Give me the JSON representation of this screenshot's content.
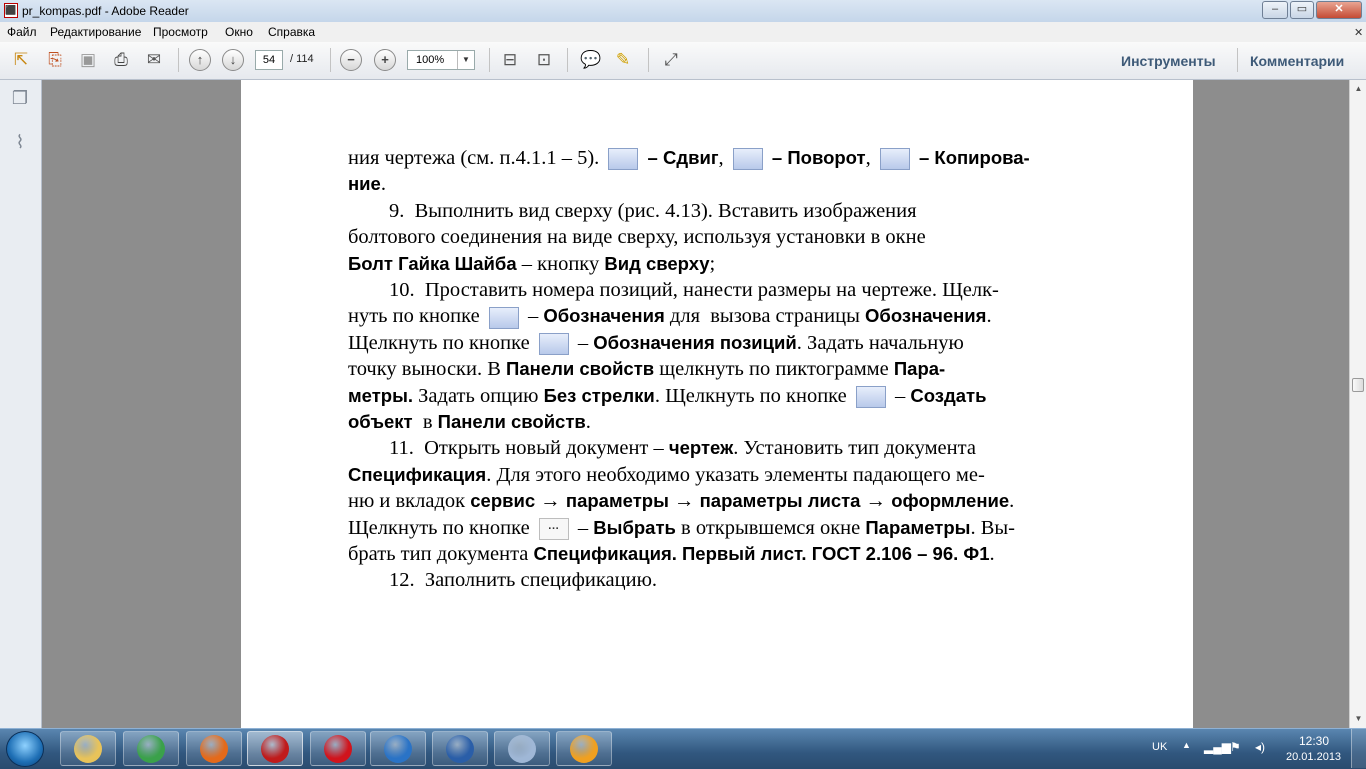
{
  "window": {
    "title": "pr_kompas.pdf - Adobe Reader",
    "app_icon": "pdf-icon",
    "controls": [
      "minimize-icon",
      "maximize-icon",
      "close-icon"
    ]
  },
  "menu": [
    "Файл",
    "Редактирование",
    "Просмотр",
    "Окно",
    "Справка"
  ],
  "toolbar": {
    "current_page": "54",
    "total_pages": "/ 114",
    "zoom": "100%",
    "tools_label": "Инструменты",
    "comments_label": "Комментарии",
    "buttons": [
      "open-icon",
      "create-pdf-icon",
      "save-icon",
      "print-icon",
      "email-icon",
      "page-up-icon",
      "page-down-icon",
      "zoom-out-icon",
      "zoom-in-icon",
      "fit-page-icon",
      "fit-width-icon",
      "comment-icon",
      "highlight-icon",
      "expand-icon"
    ]
  },
  "nav_panel": [
    "pages-icon",
    "attachments-icon"
  ],
  "document": {
    "lines": [
      {
        "parts": [
          {
            "t": "ния чертежа (см. п.4.1.1 – 5). "
          },
          {
            "icon": "shift-tool-icon"
          },
          {
            "b": " – Сдвиг"
          },
          {
            "t": ", "
          },
          {
            "icon": "rotate-tool-icon"
          },
          {
            "b": " – Поворот"
          },
          {
            "t": ", "
          },
          {
            "icon": "copy-tool-icon"
          },
          {
            "b": " – Копирова-"
          }
        ]
      },
      {
        "parts": [
          {
            "b": "ние"
          },
          {
            "t": "."
          }
        ]
      },
      {
        "parts": [
          {
            "t": "        9.  Выполнить вид сверху (рис. 4.13). Вставить изображения"
          }
        ]
      },
      {
        "parts": [
          {
            "t": "болтового соединения на виде сверху, используя установки в окне"
          }
        ]
      },
      {
        "parts": [
          {
            "b": "Болт Гайка Шайба"
          },
          {
            "t": " – кнопку "
          },
          {
            "b": "Вид сверху"
          },
          {
            "t": ";"
          }
        ]
      },
      {
        "parts": [
          {
            "t": "        10.  Проставить номера позиций, нанести размеры на чертеже. Щелк-"
          }
        ]
      },
      {
        "parts": [
          {
            "t": "нуть по кнопке "
          },
          {
            "icon": "designations-icon"
          },
          {
            "t": " – "
          },
          {
            "b": "Обозначения"
          },
          {
            "t": " для  вызова страницы "
          },
          {
            "b": "Обозначения"
          },
          {
            "t": "."
          }
        ]
      },
      {
        "parts": [
          {
            "t": "Щелкнуть по кнопке "
          },
          {
            "icon": "position-designations-icon"
          },
          {
            "t": " – "
          },
          {
            "b": "Обозначения позиций"
          },
          {
            "t": ". Задать начальную"
          }
        ]
      },
      {
        "parts": [
          {
            "t": "точку выноски. В "
          },
          {
            "b": "Панели свойств"
          },
          {
            "t": " щелкнуть по пиктограмме "
          },
          {
            "b": "Пара-"
          }
        ]
      },
      {
        "parts": [
          {
            "b": "метры."
          },
          {
            "t": " Задать опцию "
          },
          {
            "b": "Без стрелки"
          },
          {
            "t": ". Щелкнуть по кнопке "
          },
          {
            "icon": "create-object-icon"
          },
          {
            "t": " – "
          },
          {
            "b": "Создать"
          }
        ]
      },
      {
        "parts": [
          {
            "b": "объект"
          },
          {
            "t": "  в "
          },
          {
            "b": "Панели свойств"
          },
          {
            "t": "."
          }
        ]
      },
      {
        "parts": [
          {
            "t": "        11.  Открыть новый документ – "
          },
          {
            "b": "чертеж"
          },
          {
            "t": ". Установить тип документа"
          }
        ]
      },
      {
        "parts": [
          {
            "b": "Спецификация"
          },
          {
            "t": ". Для этого необходимо указать элементы падающего ме-"
          }
        ]
      },
      {
        "parts": [
          {
            "t": "ню и вкладок "
          },
          {
            "b": "сервис"
          },
          {
            "t": " → "
          },
          {
            "b": "параметры"
          },
          {
            "t": " → "
          },
          {
            "b": "параметры листа"
          },
          {
            "t": " → "
          },
          {
            "b": "оформление"
          },
          {
            "t": "."
          }
        ]
      },
      {
        "parts": [
          {
            "t": "Щелкнуть по кнопке "
          },
          {
            "icon": "ellipsis-button-icon",
            "label": "···"
          },
          {
            "t": " – "
          },
          {
            "b": "Выбрать"
          },
          {
            "t": " в открывшемся окне "
          },
          {
            "b": "Параметры"
          },
          {
            "t": ". Вы-"
          }
        ]
      },
      {
        "parts": [
          {
            "t": "брать тип документа "
          },
          {
            "b": "Спецификация. Первый лист. ГОСТ 2.106 – 96. Ф1"
          },
          {
            "t": "."
          }
        ]
      },
      {
        "parts": [
          {
            "t": "        12.  Заполнить спецификацию."
          }
        ]
      }
    ]
  },
  "taskbar": {
    "apps": [
      {
        "name": "explorer-icon",
        "color": "#e8c35a"
      },
      {
        "name": "chrome-icon",
        "color": "#3aa14a"
      },
      {
        "name": "firefox-icon",
        "color": "#e46a1a"
      },
      {
        "name": "adobe-reader-icon",
        "color": "#c01b1b"
      },
      {
        "name": "opera-icon",
        "color": "#d1141c"
      },
      {
        "name": "kompas-icon",
        "color": "#2a73c6"
      },
      {
        "name": "word-icon",
        "color": "#2a5ea8"
      },
      {
        "name": "notepad-icon",
        "color": "#9fb7d6"
      },
      {
        "name": "avast-icon",
        "color": "#f0a020"
      }
    ],
    "language": "UK",
    "time": "12:30",
    "date": "20.01.2013"
  }
}
